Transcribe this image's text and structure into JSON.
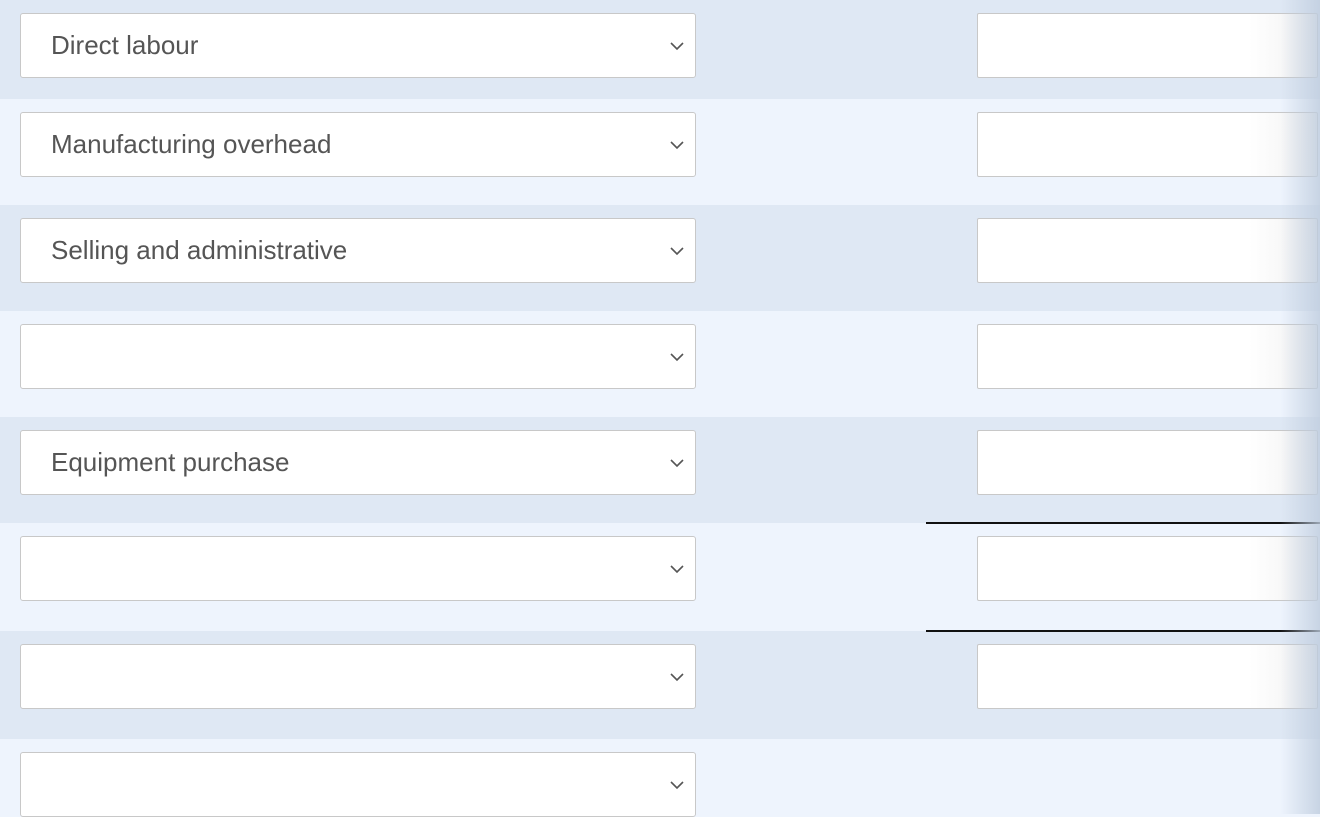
{
  "rows": [
    {
      "select": "Direct labour",
      "amount": ""
    },
    {
      "select": "Manufacturing overhead",
      "amount": ""
    },
    {
      "select": "Selling and administrative",
      "amount": ""
    },
    {
      "select": "",
      "amount": ""
    },
    {
      "select": "Equipment purchase",
      "amount": ""
    },
    {
      "select": "",
      "amount": ""
    },
    {
      "select": "",
      "amount": ""
    },
    {
      "select": ""
    }
  ],
  "colors": {
    "row_dark": "#dfe8f4",
    "row_light": "#eef4fd"
  },
  "icons": {
    "dropdown": "chevron-down-icon"
  }
}
